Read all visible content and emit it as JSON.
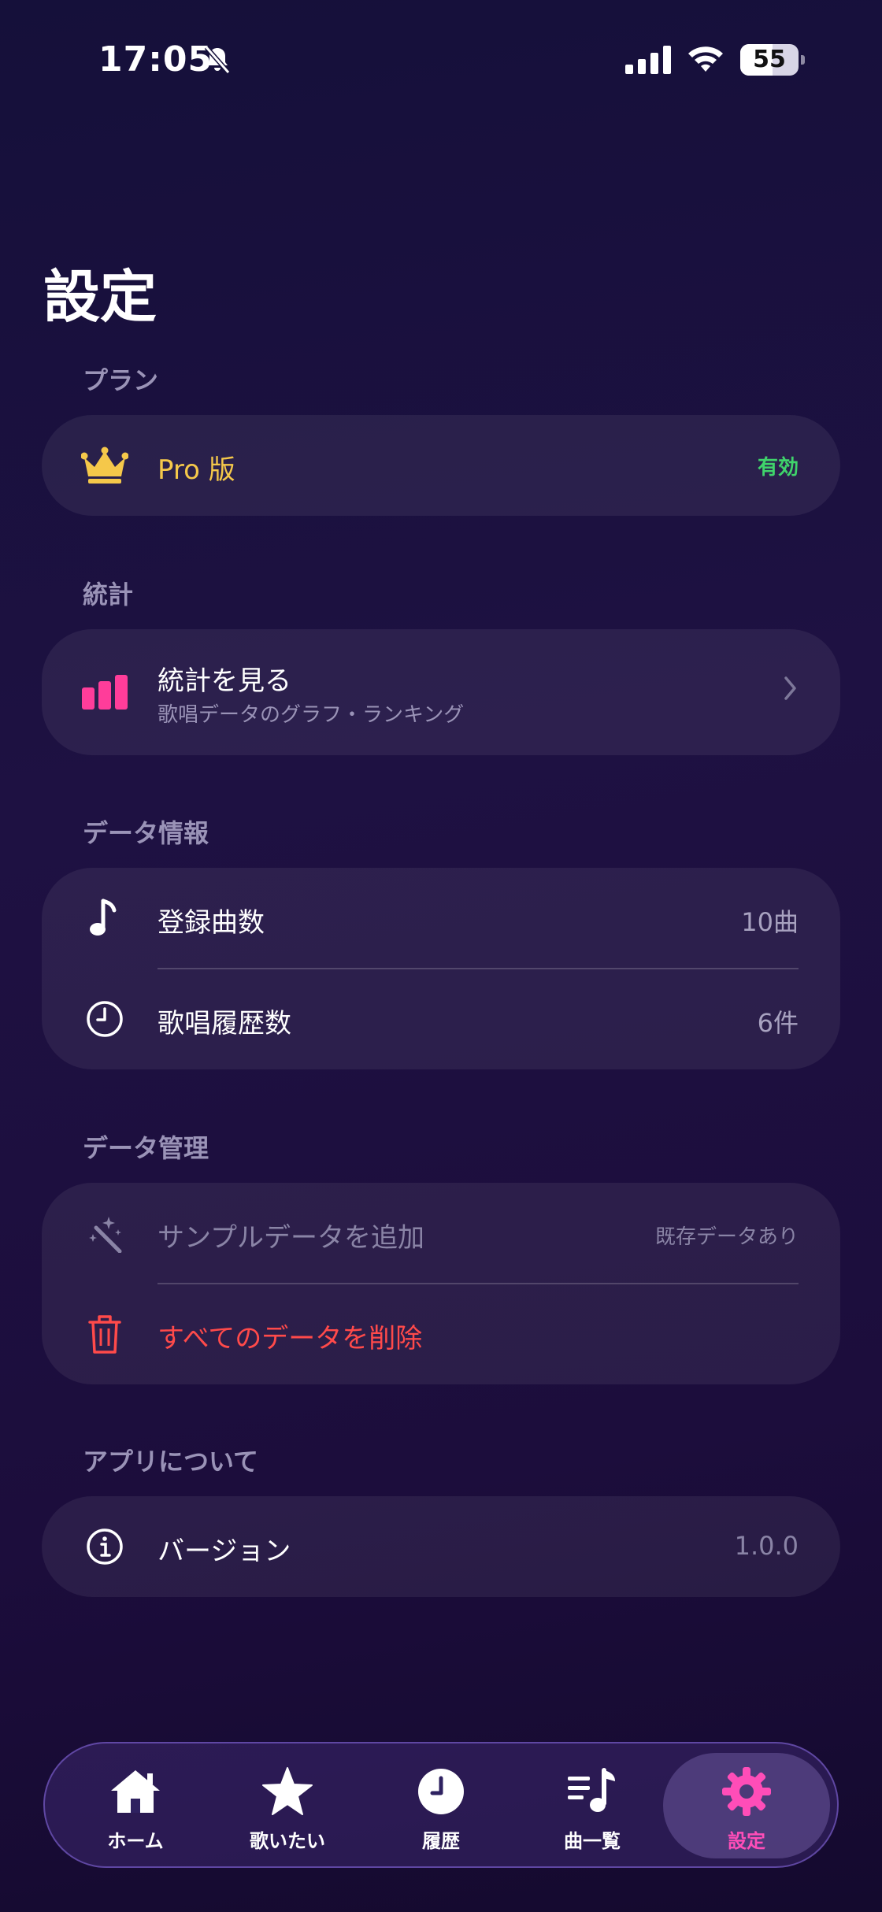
{
  "status": {
    "time": "17:05",
    "battery": "55",
    "battery_level": 0.55
  },
  "page": {
    "title": "設定"
  },
  "plan": {
    "section": "プラン",
    "name": "Pro 版",
    "status": "有効",
    "crown_color": "#f5c84a",
    "status_color": "#3fd36b"
  },
  "stats": {
    "section": "統計",
    "title": "統計を見る",
    "subtitle": "歌唱データのグラフ・ランキング",
    "icon_color": "#ff3d9a"
  },
  "data_info": {
    "section": "データ情報",
    "rows": [
      {
        "icon": "music-note-icon",
        "label": "登録曲数",
        "value": "10曲"
      },
      {
        "icon": "clock-icon",
        "label": "歌唱履歴数",
        "value": "6件"
      }
    ]
  },
  "data_management": {
    "section": "データ管理",
    "add_sample_label": "サンプルデータを追加",
    "add_sample_note": "既存データあり",
    "delete_label": "すべてのデータを削除",
    "delete_color": "#ff4a4a"
  },
  "about": {
    "section": "アプリについて",
    "version_label": "バージョン",
    "version_value": "1.0.0"
  },
  "tabs": [
    {
      "icon": "home-icon",
      "label": "ホーム",
      "active": false
    },
    {
      "icon": "star-icon",
      "label": "歌いたい",
      "active": false
    },
    {
      "icon": "clock-icon",
      "label": "履歴",
      "active": false
    },
    {
      "icon": "song-list-icon",
      "label": "曲一覧",
      "active": false
    },
    {
      "icon": "gear-icon",
      "label": "設定",
      "active": true
    }
  ],
  "colors": {
    "accent": "#ff4db8"
  }
}
